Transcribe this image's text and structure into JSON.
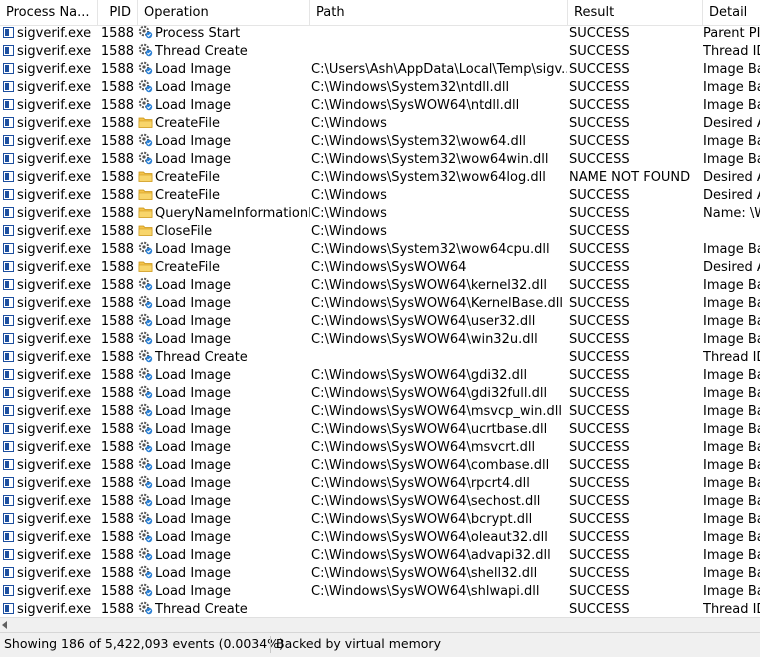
{
  "columns": [
    "Process Na...",
    "PID",
    "Operation",
    "Path",
    "Result",
    "Detail"
  ],
  "rows": [
    [
      "sigverif.exe",
      "1588",
      "process",
      "Process Start",
      "",
      "SUCCESS",
      "Parent PID"
    ],
    [
      "sigverif.exe",
      "1588",
      "process",
      "Thread Create",
      "",
      "SUCCESS",
      "Thread ID"
    ],
    [
      "sigverif.exe",
      "1588",
      "process",
      "Load Image",
      "C:\\Users\\Ash\\AppData\\Local\\Temp\\sigv...",
      "SUCCESS",
      "Image Ba"
    ],
    [
      "sigverif.exe",
      "1588",
      "process",
      "Load Image",
      "C:\\Windows\\System32\\ntdll.dll",
      "SUCCESS",
      "Image Ba"
    ],
    [
      "sigverif.exe",
      "1588",
      "process",
      "Load Image",
      "C:\\Windows\\SysWOW64\\ntdll.dll",
      "SUCCESS",
      "Image Ba"
    ],
    [
      "sigverif.exe",
      "1588",
      "file",
      "CreateFile",
      "C:\\Windows",
      "SUCCESS",
      "Desired A"
    ],
    [
      "sigverif.exe",
      "1588",
      "process",
      "Load Image",
      "C:\\Windows\\System32\\wow64.dll",
      "SUCCESS",
      "Image Ba"
    ],
    [
      "sigverif.exe",
      "1588",
      "process",
      "Load Image",
      "C:\\Windows\\System32\\wow64win.dll",
      "SUCCESS",
      "Image Ba"
    ],
    [
      "sigverif.exe",
      "1588",
      "file",
      "CreateFile",
      "C:\\Windows\\System32\\wow64log.dll",
      "NAME NOT FOUND",
      "Desired A"
    ],
    [
      "sigverif.exe",
      "1588",
      "file",
      "CreateFile",
      "C:\\Windows",
      "SUCCESS",
      "Desired A"
    ],
    [
      "sigverif.exe",
      "1588",
      "file",
      "QueryNameInformationF...",
      "C:\\Windows",
      "SUCCESS",
      "Name: \\W"
    ],
    [
      "sigverif.exe",
      "1588",
      "file",
      "CloseFile",
      "C:\\Windows",
      "SUCCESS",
      ""
    ],
    [
      "sigverif.exe",
      "1588",
      "process",
      "Load Image",
      "C:\\Windows\\System32\\wow64cpu.dll",
      "SUCCESS",
      "Image Ba"
    ],
    [
      "sigverif.exe",
      "1588",
      "file",
      "CreateFile",
      "C:\\Windows\\SysWOW64",
      "SUCCESS",
      "Desired A"
    ],
    [
      "sigverif.exe",
      "1588",
      "process",
      "Load Image",
      "C:\\Windows\\SysWOW64\\kernel32.dll",
      "SUCCESS",
      "Image Ba"
    ],
    [
      "sigverif.exe",
      "1588",
      "process",
      "Load Image",
      "C:\\Windows\\SysWOW64\\KernelBase.dll",
      "SUCCESS",
      "Image Ba"
    ],
    [
      "sigverif.exe",
      "1588",
      "process",
      "Load Image",
      "C:\\Windows\\SysWOW64\\user32.dll",
      "SUCCESS",
      "Image Ba"
    ],
    [
      "sigverif.exe",
      "1588",
      "process",
      "Load Image",
      "C:\\Windows\\SysWOW64\\win32u.dll",
      "SUCCESS",
      "Image Ba"
    ],
    [
      "sigverif.exe",
      "1588",
      "process",
      "Thread Create",
      "",
      "SUCCESS",
      "Thread ID"
    ],
    [
      "sigverif.exe",
      "1588",
      "process",
      "Load Image",
      "C:\\Windows\\SysWOW64\\gdi32.dll",
      "SUCCESS",
      "Image Ba"
    ],
    [
      "sigverif.exe",
      "1588",
      "process",
      "Load Image",
      "C:\\Windows\\SysWOW64\\gdi32full.dll",
      "SUCCESS",
      "Image Ba"
    ],
    [
      "sigverif.exe",
      "1588",
      "process",
      "Load Image",
      "C:\\Windows\\SysWOW64\\msvcp_win.dll",
      "SUCCESS",
      "Image Ba"
    ],
    [
      "sigverif.exe",
      "1588",
      "process",
      "Load Image",
      "C:\\Windows\\SysWOW64\\ucrtbase.dll",
      "SUCCESS",
      "Image Ba"
    ],
    [
      "sigverif.exe",
      "1588",
      "process",
      "Load Image",
      "C:\\Windows\\SysWOW64\\msvcrt.dll",
      "SUCCESS",
      "Image Ba"
    ],
    [
      "sigverif.exe",
      "1588",
      "process",
      "Load Image",
      "C:\\Windows\\SysWOW64\\combase.dll",
      "SUCCESS",
      "Image Ba"
    ],
    [
      "sigverif.exe",
      "1588",
      "process",
      "Load Image",
      "C:\\Windows\\SysWOW64\\rpcrt4.dll",
      "SUCCESS",
      "Image Ba"
    ],
    [
      "sigverif.exe",
      "1588",
      "process",
      "Load Image",
      "C:\\Windows\\SysWOW64\\sechost.dll",
      "SUCCESS",
      "Image Ba"
    ],
    [
      "sigverif.exe",
      "1588",
      "process",
      "Load Image",
      "C:\\Windows\\SysWOW64\\bcrypt.dll",
      "SUCCESS",
      "Image Ba"
    ],
    [
      "sigverif.exe",
      "1588",
      "process",
      "Load Image",
      "C:\\Windows\\SysWOW64\\oleaut32.dll",
      "SUCCESS",
      "Image Ba"
    ],
    [
      "sigverif.exe",
      "1588",
      "process",
      "Load Image",
      "C:\\Windows\\SysWOW64\\advapi32.dll",
      "SUCCESS",
      "Image Ba"
    ],
    [
      "sigverif.exe",
      "1588",
      "process",
      "Load Image",
      "C:\\Windows\\SysWOW64\\shell32.dll",
      "SUCCESS",
      "Image Ba"
    ],
    [
      "sigverif.exe",
      "1588",
      "process",
      "Load Image",
      "C:\\Windows\\SysWOW64\\shlwapi.dll",
      "SUCCESS",
      "Image Ba"
    ],
    [
      "sigverif.exe",
      "1588",
      "process",
      "Thread Create",
      "",
      "SUCCESS",
      "Thread ID"
    ]
  ],
  "icons": {
    "process": "gear-process-icon",
    "file": "folder-icon"
  },
  "status": {
    "events": "Showing 186 of 5,422,093 events (0.0034%)",
    "memory": "Backed by virtual memory"
  }
}
